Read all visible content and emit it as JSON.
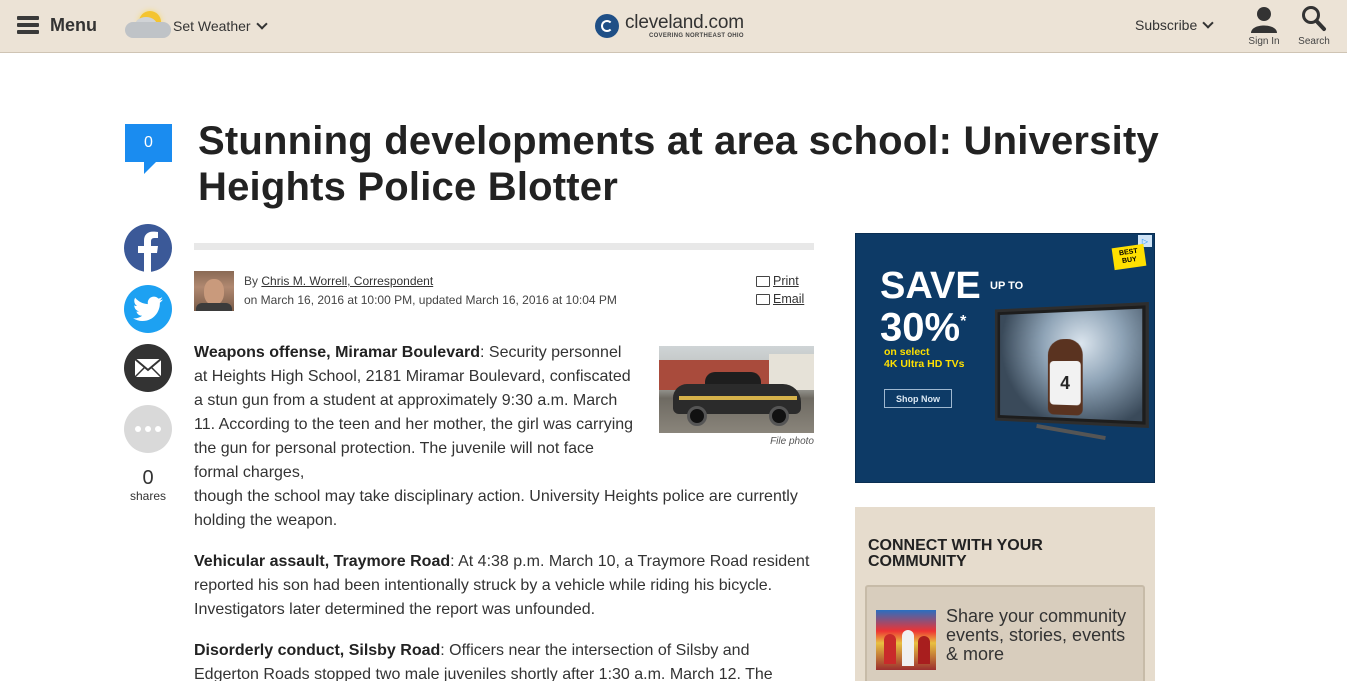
{
  "header": {
    "menu_label": "Menu",
    "weather_label": "Set Weather",
    "logo_name": "cleveland.com",
    "logo_tagline": "COVERING NORTHEAST OHIO",
    "subscribe_label": "Subscribe",
    "signin_label": "Sign In",
    "search_label": "Search"
  },
  "social": {
    "comment_count": "0",
    "share_count": "0",
    "shares_label": "shares"
  },
  "article": {
    "headline": "Stunning developments at area school: University Heights Police Blotter",
    "by_prefix": "By",
    "author": "Chris M. Worrell, Correspondent",
    "dateline": "on March 16, 2016 at 10:00 PM, updated March 16, 2016 at 10:04 PM",
    "print_label": "Print",
    "email_label": "Email",
    "photo_credit": "File photo",
    "p1_head": "Weapons offense, Miramar Boulevard",
    "p1_text_a": ": Security personnel at Heights High School, 2181 Miramar Boulevard, confiscated a stun gun from a student at approximately 9:30 a.m. March 11. According to the teen and her mother, the girl was carrying the gun for personal protection. The juvenile will not face formal charges,",
    "p1_text_b": "though the school may take disciplinary action. University Heights police are currently holding the weapon.",
    "p2_head": "Vehicular assault, Traymore Road",
    "p2_text": ": At 4:38 p.m. March 10, a Traymore Road resident reported his son had been intentionally struck by a vehicle while riding his bicycle. Investigators later determined the report was unfounded.",
    "p3_head": "Disorderly conduct, Silsby Road",
    "p3_text": ": Officers near the intersection of Silsby and Edgerton Roads stopped two male juveniles shortly after 1:30 a.m. March 12. The"
  },
  "ad": {
    "save": "SAVE",
    "up_to": "UP TO",
    "percent": "30%",
    "asterisk": "*",
    "on_select": "on select",
    "product": "4K Ultra HD TVs",
    "shop_now": "Shop Now",
    "brand": "BEST BUY",
    "jersey_number": "4"
  },
  "community": {
    "title": "CONNECT WITH YOUR COMMUNITY",
    "card_text": "Share your community events, stories, events & more"
  },
  "colors": {
    "header_bg": "#ece3d6",
    "accent_blue": "#1a8cf0",
    "facebook": "#3b5998",
    "twitter": "#1da1f2",
    "ad_bg": "#0d3a66",
    "ad_yellow": "#ffe000",
    "community_bg": "#e6dccd"
  }
}
